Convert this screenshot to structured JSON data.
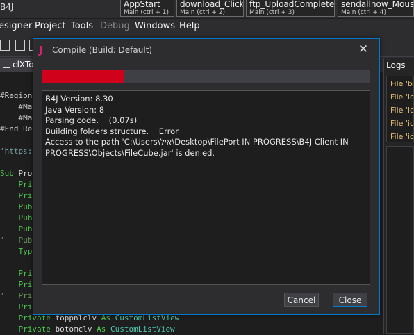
{
  "app": {
    "title": "B4J"
  },
  "sub_tabs": [
    {
      "name": "AppStart",
      "shortcut": "Main  (ctrl + 1)"
    },
    {
      "name": "download_Click",
      "shortcut": "Main  (ctrl + 2)"
    },
    {
      "name": "ftp_UploadCompleted",
      "shortcut": "Main  (ctrl + 3)"
    },
    {
      "name": "sendallnow_MouseC",
      "shortcut": "Main  (ctrl + 4)"
    }
  ],
  "menu": [
    "esigner",
    "Project",
    "Tools",
    "Debug",
    "Windows",
    "Help"
  ],
  "editor": {
    "doc_tab": "clXTo",
    "lines": [
      {
        "parts": [
          [
            "#Region",
            "dir"
          ]
        ]
      },
      {
        "parts": [
          [
            "    #Ma",
            "dir"
          ]
        ]
      },
      {
        "parts": [
          [
            "    #Ma",
            "dir"
          ]
        ]
      },
      {
        "parts": [
          [
            "#End Re",
            "dir"
          ]
        ]
      },
      {
        "parts": [
          [
            "",
            "ident"
          ]
        ]
      },
      {
        "parts": [
          [
            "'https:",
            "str"
          ]
        ]
      },
      {
        "parts": [
          [
            "",
            "ident"
          ]
        ]
      },
      {
        "parts": [
          [
            "Sub ",
            "kw2"
          ],
          [
            "Pro",
            "ident"
          ]
        ]
      },
      {
        "parts": [
          [
            "    Priv",
            "kw2"
          ]
        ]
      },
      {
        "parts": [
          [
            "    Priv",
            "kw2"
          ]
        ]
      },
      {
        "parts": [
          [
            "    Pub",
            "kw2"
          ]
        ]
      },
      {
        "parts": [
          [
            "    Pub",
            "kw2"
          ]
        ]
      },
      {
        "parts": [
          [
            "    Pub",
            "kw2"
          ]
        ]
      },
      {
        "parts": [
          [
            "'   Pub",
            "cmt"
          ]
        ]
      },
      {
        "parts": [
          [
            "    Typ",
            "kw2"
          ]
        ]
      },
      {
        "parts": [
          [
            "",
            "ident"
          ]
        ]
      },
      {
        "parts": [
          [
            "    Priv",
            "kw2"
          ]
        ]
      },
      {
        "parts": [
          [
            "    Priv",
            "kw2"
          ]
        ]
      },
      {
        "parts": [
          [
            "'   Priv",
            "cmt"
          ]
        ]
      },
      {
        "parts": [
          [
            "    Priv",
            "kw2"
          ]
        ]
      },
      {
        "parts": [
          [
            "    Private ",
            "kw2"
          ],
          [
            "toppnlclv ",
            "ident"
          ],
          [
            "As ",
            "kw2"
          ],
          [
            "CustomListView",
            "typ"
          ]
        ]
      },
      {
        "parts": [
          [
            "    Private ",
            "kw2"
          ],
          [
            "botomclv ",
            "ident"
          ],
          [
            "As ",
            "kw2"
          ],
          [
            "CustomListView",
            "typ"
          ]
        ]
      }
    ]
  },
  "logs": {
    "title": "Logs",
    "entries": [
      "File 'bl",
      "File 'ic",
      "File 'ic",
      "File 'ic",
      "File 'ic"
    ]
  },
  "dialog": {
    "logo": "J",
    "title": "Compile (Build: Default)",
    "close_symbol": "✕",
    "progress": 0.25,
    "progress_color": "#d0021b",
    "output": [
      "B4J Version: 8.30",
      "Java Version: 8",
      "Parsing code.    (0.07s)",
      "Building folders structure.    Error",
      "Access to the path 'C:\\Users\\איל\\Desktop\\FilePort IN PROGRESS\\B4J Client IN PROGRESS\\Objects\\FileCube.jar' is denied."
    ],
    "cancel_label": "Cancel",
    "close_label": "Close"
  }
}
